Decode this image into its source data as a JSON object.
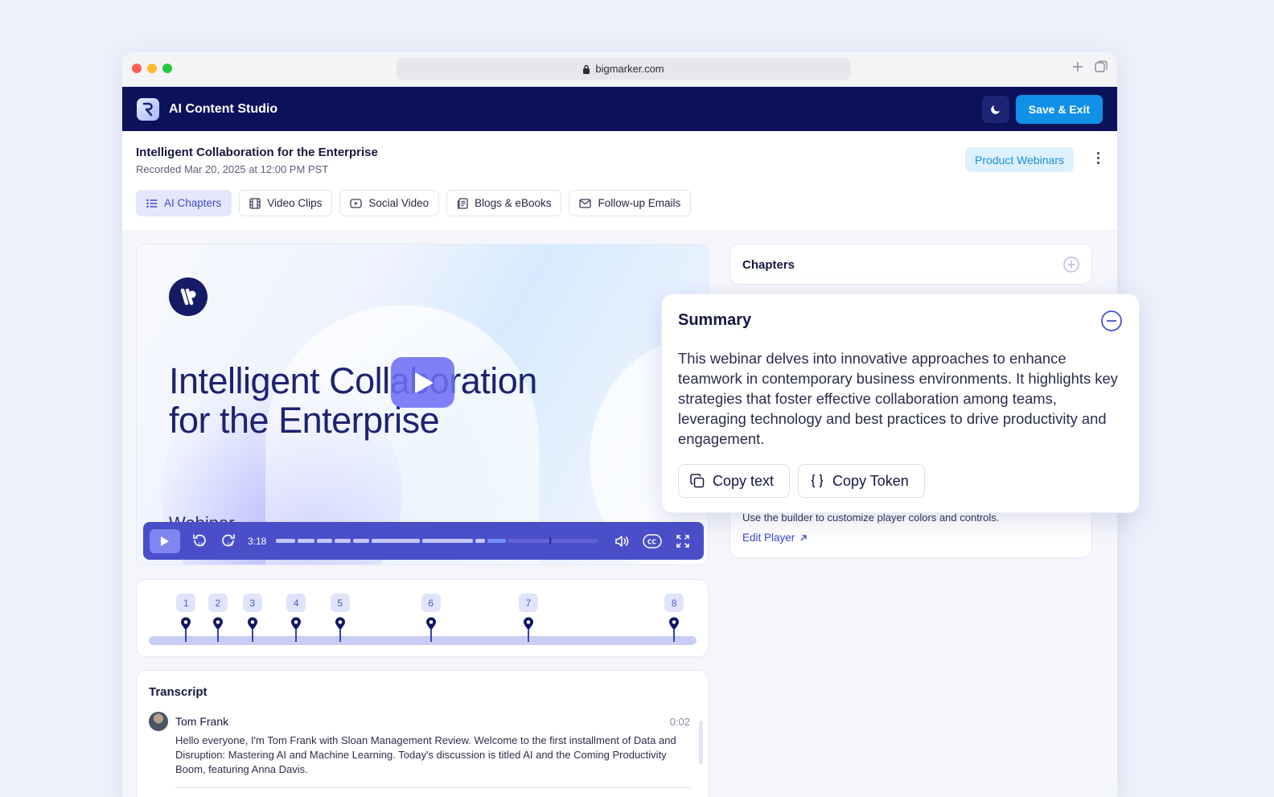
{
  "browser": {
    "url": "bigmarker.com"
  },
  "app": {
    "title": "AI Content Studio",
    "save_label": "Save & Exit"
  },
  "header": {
    "title": "Intelligent Collaboration for the Enterprise",
    "recorded": "Recorded Mar 20, 2025 at 12:00 PM PST",
    "tag": "Product Webinars"
  },
  "tabs": [
    {
      "label": "AI Chapters",
      "icon": "list-icon",
      "active": true
    },
    {
      "label": "Video Clips",
      "icon": "film-icon"
    },
    {
      "label": "Social Video",
      "icon": "play-rect-icon"
    },
    {
      "label": "Blogs & eBooks",
      "icon": "document-icon"
    },
    {
      "label": "Follow-up Emails",
      "icon": "mail-icon"
    }
  ],
  "video": {
    "title_line1": "Intelligent Collaboration",
    "title_line2": "for the Enterprise",
    "subtitle": "Webinar",
    "time": "3:18",
    "progress_fraction": 0.85
  },
  "chapters_timeline": {
    "markers": [
      "1",
      "2",
      "3",
      "4",
      "5",
      "6",
      "7",
      "8"
    ],
    "positions": [
      0.068,
      0.126,
      0.189,
      0.269,
      0.349,
      0.515,
      0.693,
      0.959
    ]
  },
  "transcript": {
    "title": "Transcript",
    "entries": [
      {
        "speaker": "Tom Frank",
        "time": "0:02",
        "text": "Hello everyone, I'm Tom Frank with Sloan Management Review. Welcome to the first installment of Data and Disruption: Mastering AI and Machine Learning. Today's discussion is titled AI and the Coming Productivity Boom, featuring Anna Davis."
      }
    ]
  },
  "chapters_panel": {
    "title": "Chapters"
  },
  "player_panel": {
    "text": "Use the builder to customize player colors and controls.",
    "link": "Edit Player"
  },
  "summary": {
    "title": "Summary",
    "text": "This webinar delves into innovative approaches to enhance teamwork in contemporary business environments. It highlights key strategies that foster effective collaboration among teams, leveraging technology and best practices to drive productivity and engagement.",
    "copy_text_label": "Copy text",
    "copy_token_label": "Copy Token"
  },
  "colors": {
    "appbar": "#0c1259",
    "accent": "#1090e6",
    "player": "#4a4fc9"
  }
}
